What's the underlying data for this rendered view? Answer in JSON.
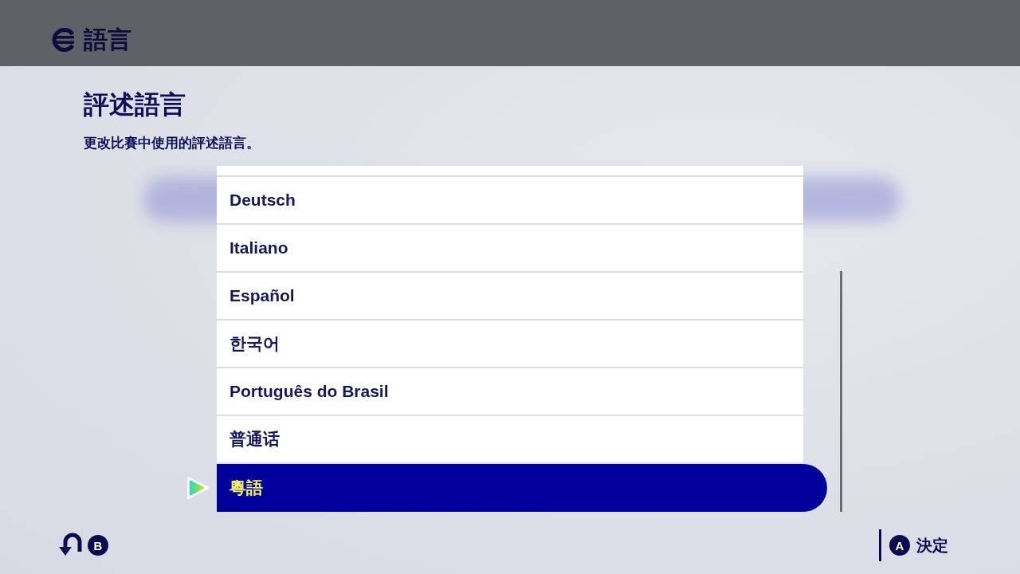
{
  "header": {
    "title": "語言"
  },
  "section": {
    "title": "評述語言",
    "description": "更改比賽中使用的評述語言。"
  },
  "languages": [
    {
      "label": "Deutsch",
      "selected": false
    },
    {
      "label": "Italiano",
      "selected": false
    },
    {
      "label": "Español",
      "selected": false
    },
    {
      "label": "한국어",
      "selected": false
    },
    {
      "label": "Português do Brasil",
      "selected": false
    },
    {
      "label": "普通话",
      "selected": false
    },
    {
      "label": "粵語",
      "selected": true
    }
  ],
  "footer": {
    "back": {
      "button": "B"
    },
    "confirm": {
      "button": "A",
      "label": "決定"
    }
  }
}
